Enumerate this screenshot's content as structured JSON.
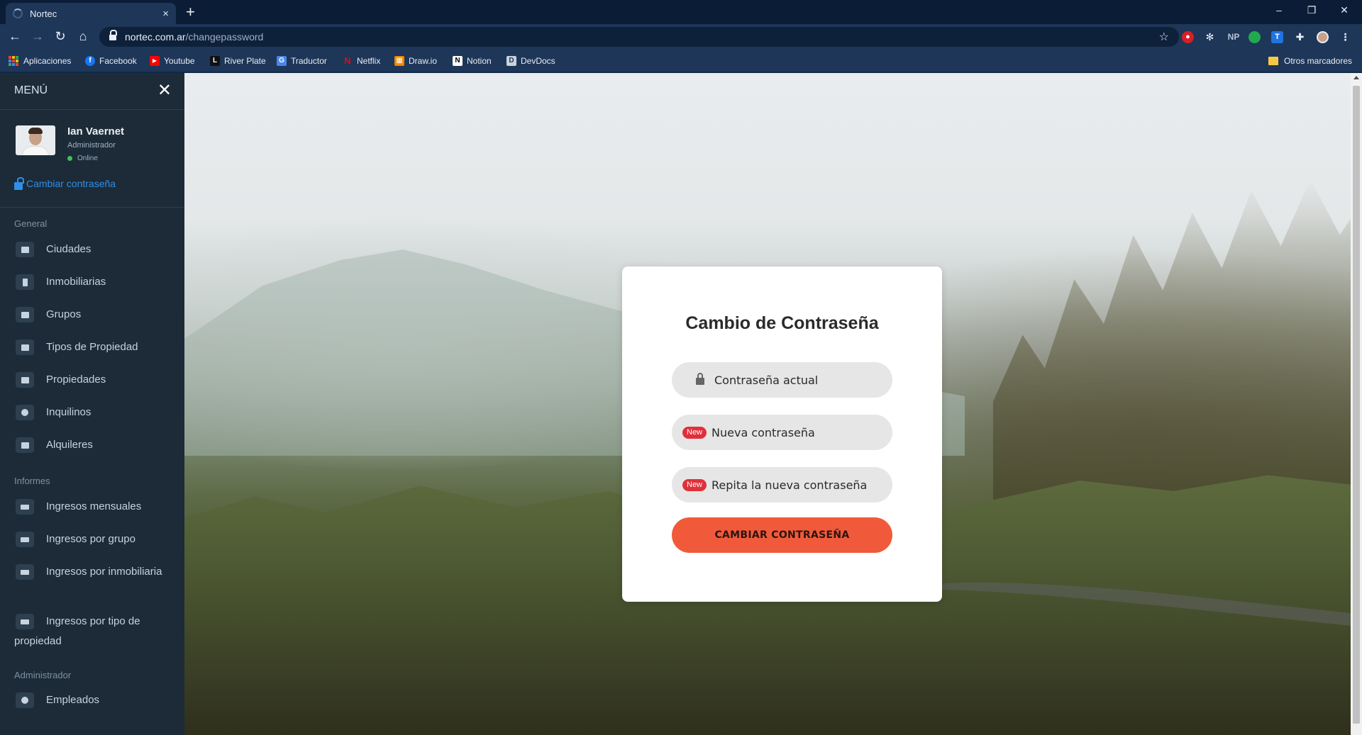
{
  "browser": {
    "tab_title": "Nortec",
    "tab_close": "×",
    "new_tab": "+",
    "url_host": "nortec.com.ar",
    "url_path": "/changepassword",
    "window_controls": {
      "minimize": "–",
      "restore": "❐",
      "close": "✕"
    },
    "extension_np": "NP",
    "extension_t": "T",
    "bookmarks": [
      {
        "label": "Aplicaciones"
      },
      {
        "label": "Facebook",
        "fav": "f",
        "color": "#1877f2"
      },
      {
        "label": "Youtube",
        "fav": "▶",
        "color": "#ff0000"
      },
      {
        "label": "River Plate",
        "fav": "L",
        "color": "#111111"
      },
      {
        "label": "Traductor",
        "fav": "G",
        "color": "#4a86e8"
      },
      {
        "label": "Netflix",
        "fav": "N",
        "color": "#e50914"
      },
      {
        "label": "Draw.io",
        "fav": "▦",
        "color": "#f08705"
      },
      {
        "label": "Notion",
        "fav": "N",
        "color": "#ffffff"
      },
      {
        "label": "DevDocs",
        "fav": "D",
        "color": "#c9d3df"
      }
    ],
    "other_bookmarks": "Otros marcadores"
  },
  "sidebar": {
    "title": "MENÚ",
    "close": "✕",
    "user": {
      "name": "Ian Vaernet",
      "role": "Administrador",
      "status": "Online"
    },
    "change_password_link": "Cambiar contraseña",
    "sections": {
      "general": "General",
      "informes": "Informes",
      "administrador": "Administrador"
    },
    "items": {
      "ciudades": "Ciudades",
      "inmobiliarias": "Inmobiliarias",
      "grupos": "Grupos",
      "tipos_propiedad": "Tipos de Propiedad",
      "propiedades": "Propiedades",
      "inquilinos": "Inquilinos",
      "alquileres": "Alquileres",
      "ingresos_mensuales": "Ingresos mensuales",
      "ingresos_grupo": "Ingresos por grupo",
      "ingresos_inmobiliaria": "Ingresos por inmobiliaria",
      "ingresos_tipo": "Ingresos por tipo de propiedad",
      "empleados": "Empleados"
    }
  },
  "form": {
    "title": "Cambio de Contraseña",
    "current_placeholder": "Contraseña actual",
    "new_badge": "New",
    "new_placeholder": "Nueva contraseña",
    "repeat_badge": "New",
    "repeat_placeholder": "Repita la nueva contraseña",
    "submit_label": "CAMBIAR CONTRASEÑA"
  },
  "colors": {
    "accent_button": "#f05a3a",
    "badge": "#e0303a",
    "link": "#2f8fe8",
    "sidebar_bg": "#1c2b37",
    "online": "#3fbf5f"
  }
}
